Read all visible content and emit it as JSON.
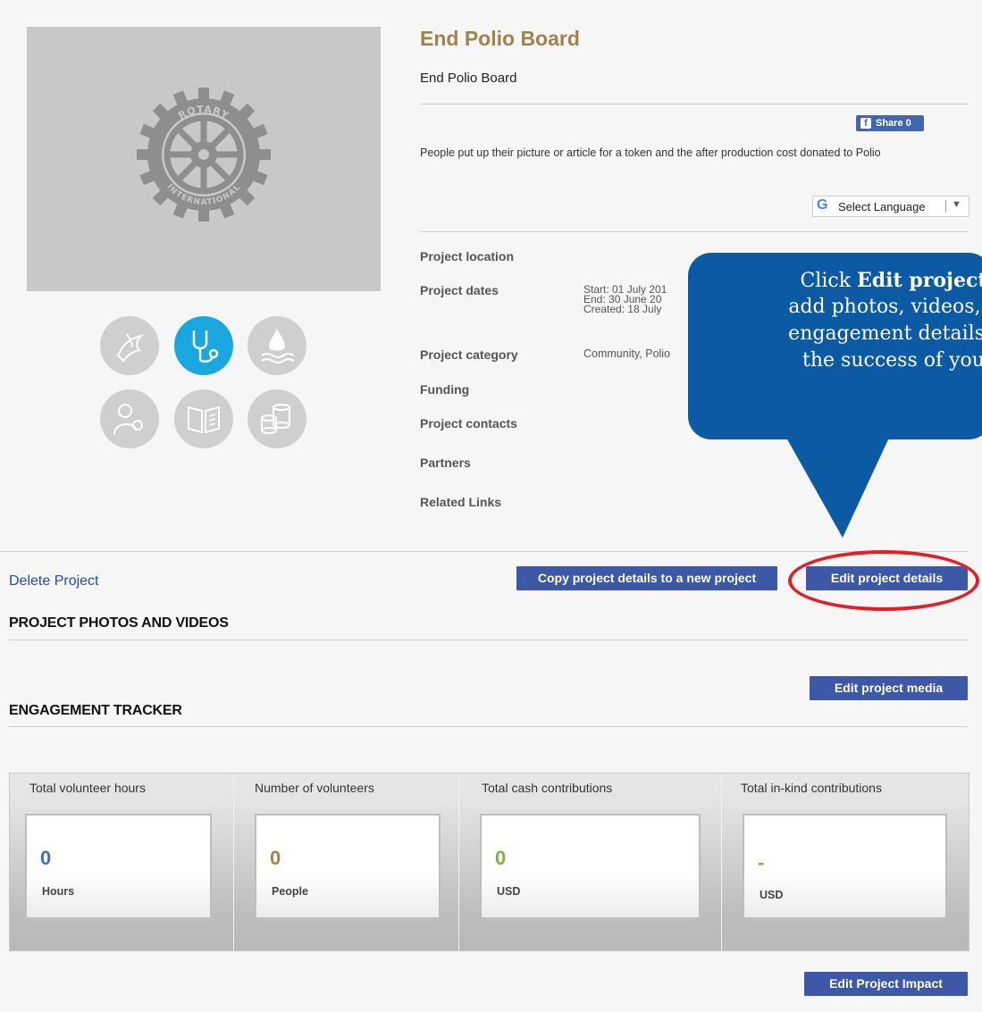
{
  "project": {
    "title": "End Polio Board",
    "subtitle": "End Polio Board",
    "description": "People put up their picture or article for a token and the after production cost donated to Polio",
    "share_label": "Share 0",
    "language_label": "Select Language",
    "logo_text_top": "ROTARY",
    "logo_text_bottom": "INTERNATIONAL"
  },
  "details": {
    "location_label": "Project location",
    "dates_label": "Project dates",
    "date_start": "Start: 01 July 201",
    "date_end": "End:  30 June 20",
    "date_created": "Created: 18 July",
    "category_label": "Project category",
    "category_value": "Community, Polio",
    "funding_label": "Funding",
    "contacts_label": "Project contacts",
    "partners_label": "Partners",
    "links_label": "Related Links"
  },
  "area_icons": [
    "peace-dove-icon",
    "stethoscope-icon",
    "water-drop-icon",
    "mother-child-icon",
    "book-icon",
    "coins-icon"
  ],
  "callout": {
    "prefix": "Click ",
    "bold": "Edit project",
    "line2": "add photos, videos, a",
    "line3": "engagement details t",
    "line4": "the success of you"
  },
  "actions": {
    "delete": "Delete Project",
    "copy": "Copy project details to a new project",
    "edit_details": "Edit project details",
    "edit_media": "Edit project media",
    "edit_impact": "Edit Project Impact"
  },
  "sections": {
    "media": "PROJECT PHOTOS AND VIDEOS",
    "tracker": "ENGAGEMENT TRACKER"
  },
  "tracker": [
    {
      "label": "Total volunteer hours",
      "value": "0",
      "unit": "Hours",
      "color": "#3f6ec0"
    },
    {
      "label": "Number of volunteers",
      "value": "0",
      "unit": "People",
      "color": "#a0824a"
    },
    {
      "label": "Total cash contributions",
      "value": "0",
      "unit": "USD",
      "color": "#7cb53f"
    },
    {
      "label": "Total in-kind contributions",
      "value": "-",
      "unit": "USD",
      "color": "#7cb53f"
    }
  ],
  "colors": {
    "title": "#a0824a",
    "button": "#3d58a6",
    "callout": "#0b5aa3",
    "active_icon": "#19a7e0",
    "highlight_oval": "#e11f26"
  }
}
